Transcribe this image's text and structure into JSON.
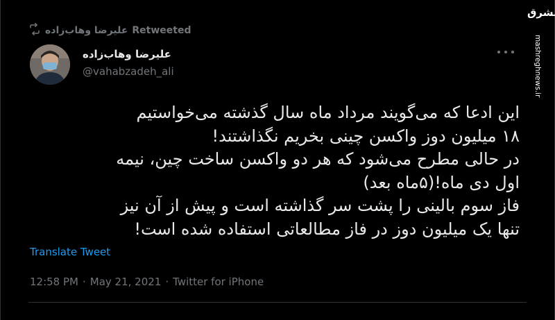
{
  "retweet": {
    "icon": "retweet-icon",
    "user": "علیرضا وهاب‌زاده",
    "label": "Retweeted"
  },
  "author": {
    "display_name": "علیرضا وهاب‌زاده",
    "handle": "@vahabzadeh_ali"
  },
  "tweet": {
    "lines": [
      "این ادعا که می‌گویند مرداد ماه سال گذشته می‌خواستیم",
      "۱۸ میلیون دوز واکسن چینی بخریم نگذاشتند!",
      "در حالی مطرح می‌شود که هر دو واکسن ساخت چین، نیمه",
      "اول دی ماه!(۵ماه بعد)",
      "فاز سوم بالینی را پشت سر گذاشته است و پیش از آن نیز",
      "تنها یک میلیون دوز در فاز مطالعاتی استفاده شده است!"
    ]
  },
  "translate_label": "Translate Tweet",
  "meta": {
    "time": "12:58 PM",
    "sep1": "·",
    "date": "May 21, 2021",
    "sep2": "·",
    "source": "Twitter for iPhone"
  },
  "watermark": {
    "logo_text": "مشرق",
    "url": "mashreghnews.ir"
  },
  "colors": {
    "background": "#000000",
    "text": "#e7e9ea",
    "muted": "#71767b",
    "link": "#1d9bf0"
  }
}
